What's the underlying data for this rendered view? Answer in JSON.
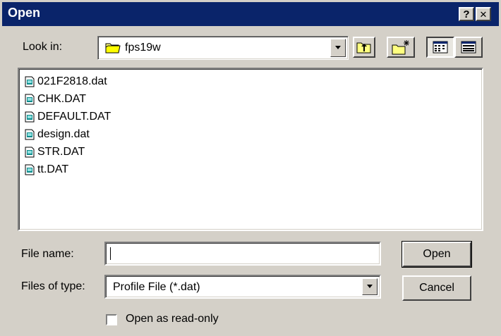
{
  "window": {
    "title": "Open",
    "help_label": "?",
    "close_label": "✕"
  },
  "look_in": {
    "label": "Look in:",
    "value": "fps19w"
  },
  "toolbar": {
    "up_folder_icon": "up-one-level-icon",
    "new_folder_icon": "create-new-folder-icon",
    "list_view_icon": "list-view-icon",
    "details_view_icon": "details-view-icon"
  },
  "files": [
    {
      "name": "021F2818.dat"
    },
    {
      "name": "CHK.DAT"
    },
    {
      "name": "DEFAULT.DAT"
    },
    {
      "name": "design.dat"
    },
    {
      "name": "STR.DAT"
    },
    {
      "name": "tt.DAT"
    }
  ],
  "file_name": {
    "label": "File name:",
    "value": ""
  },
  "files_of_type": {
    "label": "Files of type:",
    "value": "Profile File (*.dat)"
  },
  "readonly": {
    "label": "Open as read-only",
    "checked": false
  },
  "buttons": {
    "open": "Open",
    "cancel": "Cancel"
  }
}
